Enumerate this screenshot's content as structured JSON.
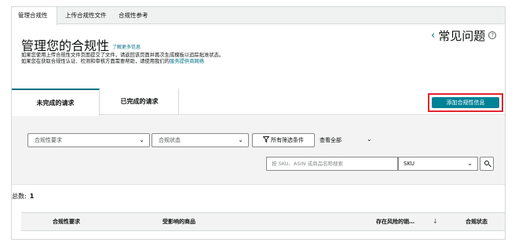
{
  "topnav": {
    "tabs": [
      {
        "label": "管理合规性",
        "active": true
      },
      {
        "label": "上传合规性文件",
        "active": false
      },
      {
        "label": "合规性参考",
        "active": false
      }
    ]
  },
  "header": {
    "title": "管理您的合规性",
    "learn_more": "了解更多信息",
    "desc_line1": "如果您使用上传合规性文件页面提交了文件，请返回该页面并再次生成模板以追踪批准状态。",
    "desc_line2_prefix": "如果您在获取合规性认证、检测和审核方面需要帮助，请使用我们的",
    "desc_line2_link": "服务提供商网络",
    "faq_label": "常见问题",
    "faq_chevron": "‹",
    "help_glyph": "?"
  },
  "request_tabs": [
    {
      "label": "未完成的请求",
      "active": true
    },
    {
      "label": "已完成的请求",
      "active": false
    }
  ],
  "add_button": "添加合规性信息",
  "filters": {
    "requirement_placeholder": "合规性要求",
    "status_placeholder": "合规状态",
    "all_filters_label": "所有筛选条件",
    "view_all_label": "查看全部",
    "search_placeholder": "按 SKU、ASIN 或商品名称搜索",
    "search_type_value": "SKU",
    "caret": "⌄"
  },
  "summary": {
    "total_label": "总数:",
    "total_value": "1"
  },
  "table": {
    "headers": [
      "合规性要求",
      "受影响的商品",
      "存在风险的销…",
      "合规状态"
    ],
    "sort_glyph": "↓"
  },
  "colors": {
    "accent": "#008296",
    "link": "#007185",
    "highlight_border": "#e3252d",
    "filter_bg": "#f3f3f3"
  }
}
